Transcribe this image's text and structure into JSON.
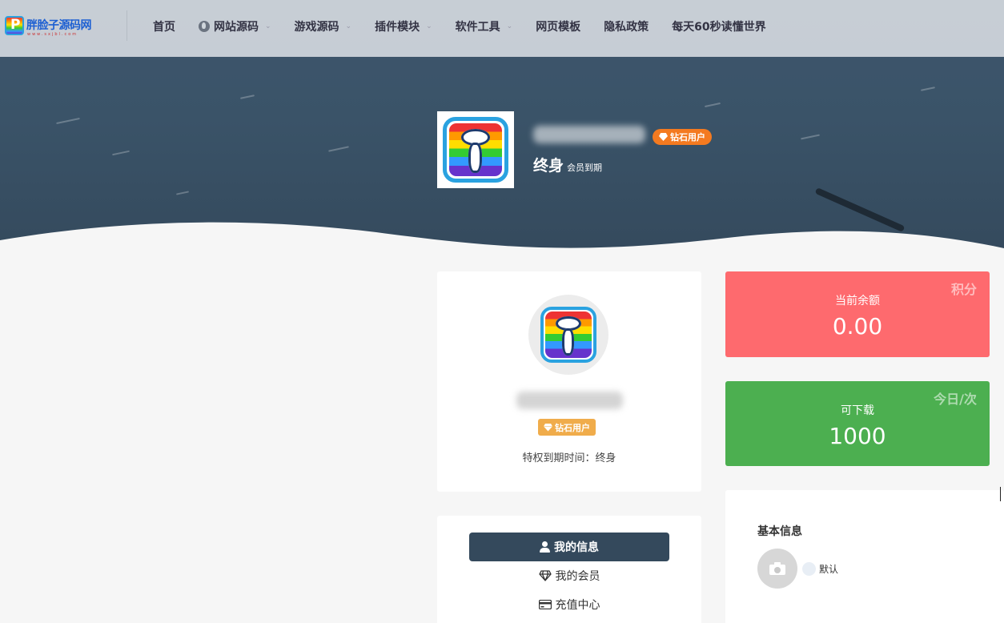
{
  "site": {
    "logo_text": "胖脸子源码网",
    "logo_sub": "www.sxjbl.com"
  },
  "nav": {
    "items": [
      {
        "label": "首页",
        "has_caret": false,
        "icon": ""
      },
      {
        "label": "网站源码",
        "has_caret": true,
        "icon": "globe-icon"
      },
      {
        "label": "游戏源码",
        "has_caret": true,
        "icon": ""
      },
      {
        "label": "插件模块",
        "has_caret": true,
        "icon": ""
      },
      {
        "label": "软件工具",
        "has_caret": true,
        "icon": ""
      },
      {
        "label": "网页模板",
        "has_caret": false,
        "icon": ""
      },
      {
        "label": "隐私政策",
        "has_caret": false,
        "icon": ""
      },
      {
        "label": "每天60秒读懂世界",
        "has_caret": false,
        "icon": ""
      }
    ]
  },
  "hero": {
    "vip_label": "钻石用户",
    "expire_value": "终身",
    "expire_label": "会员到期"
  },
  "profile": {
    "vip_label": "钻石用户",
    "expire_text": "特权到期时间：终身"
  },
  "menu": {
    "items": [
      {
        "label": "我的信息",
        "active": true,
        "icon": "user-icon"
      },
      {
        "label": "我的会员",
        "active": false,
        "icon": "diamond-icon"
      },
      {
        "label": "充值中心",
        "active": false,
        "icon": "credit-card-icon"
      }
    ]
  },
  "balance": {
    "corner": "积分",
    "label": "当前余额",
    "value": "0.00",
    "color": "#fe6a6e"
  },
  "downloads": {
    "corner": "今日/次",
    "label": "可下载",
    "value": "1000",
    "color": "#4caf50"
  },
  "info": {
    "title": "基本信息",
    "default_label": "默认"
  },
  "colors": {
    "accent_dark": "#34495c",
    "vip_orange": "#f47a20",
    "vip_gold": "#f0ac4b"
  }
}
